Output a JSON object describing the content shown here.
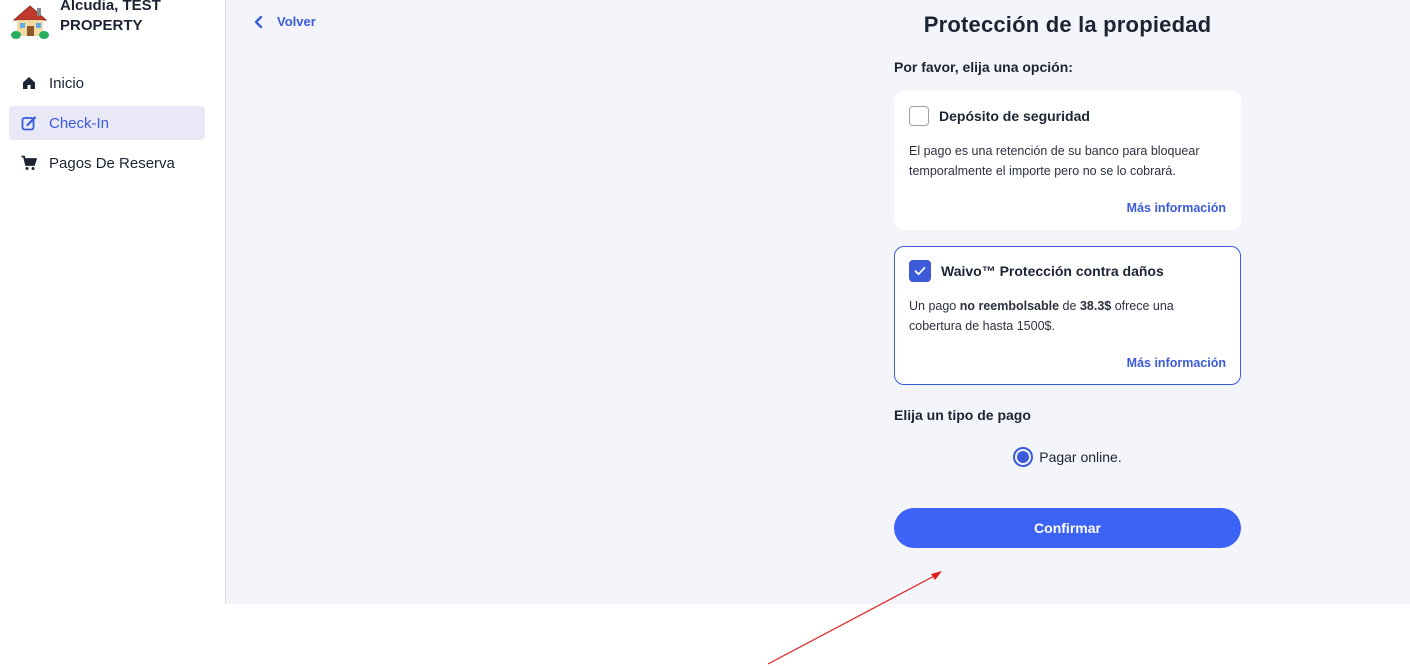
{
  "sidebar": {
    "brand": {
      "line1": "Alcudia, TEST",
      "line2": "PROPERTY",
      "logo": "house-icon"
    },
    "items": [
      {
        "label": "Inicio",
        "icon": "home-icon",
        "active": false
      },
      {
        "label": "Check-In",
        "icon": "edit-icon",
        "active": true
      },
      {
        "label": "Pagos De Reserva",
        "icon": "cart-icon",
        "active": false
      }
    ]
  },
  "header": {
    "back_label": "Volver"
  },
  "main": {
    "title": "Protección de la propiedad",
    "subtitle": "Por favor, elija una opción:",
    "options": [
      {
        "title": "Depósito de seguridad",
        "checked": false,
        "desc": "El pago es una retención de su banco para bloquear temporalmente el importe pero no se lo cobrará.",
        "more": "Más información"
      },
      {
        "title": "Waivo™ Protección contra daños",
        "checked": true,
        "desc_pre": "Un pago ",
        "desc_bold1": "no reembolsable",
        "desc_mid": " de ",
        "desc_bold2": "38.3$",
        "desc_post": " ofrece una cobertura de hasta 1500$.",
        "more": "Más información"
      }
    ],
    "payment_title": "Elija un tipo de pago",
    "payment_option": "Pagar online.",
    "confirm_label": "Confirmar"
  },
  "colors": {
    "accent": "#3b5bdb",
    "button": "#3b63f5",
    "background": "#f4f5fa",
    "arrow": "#e02020"
  }
}
